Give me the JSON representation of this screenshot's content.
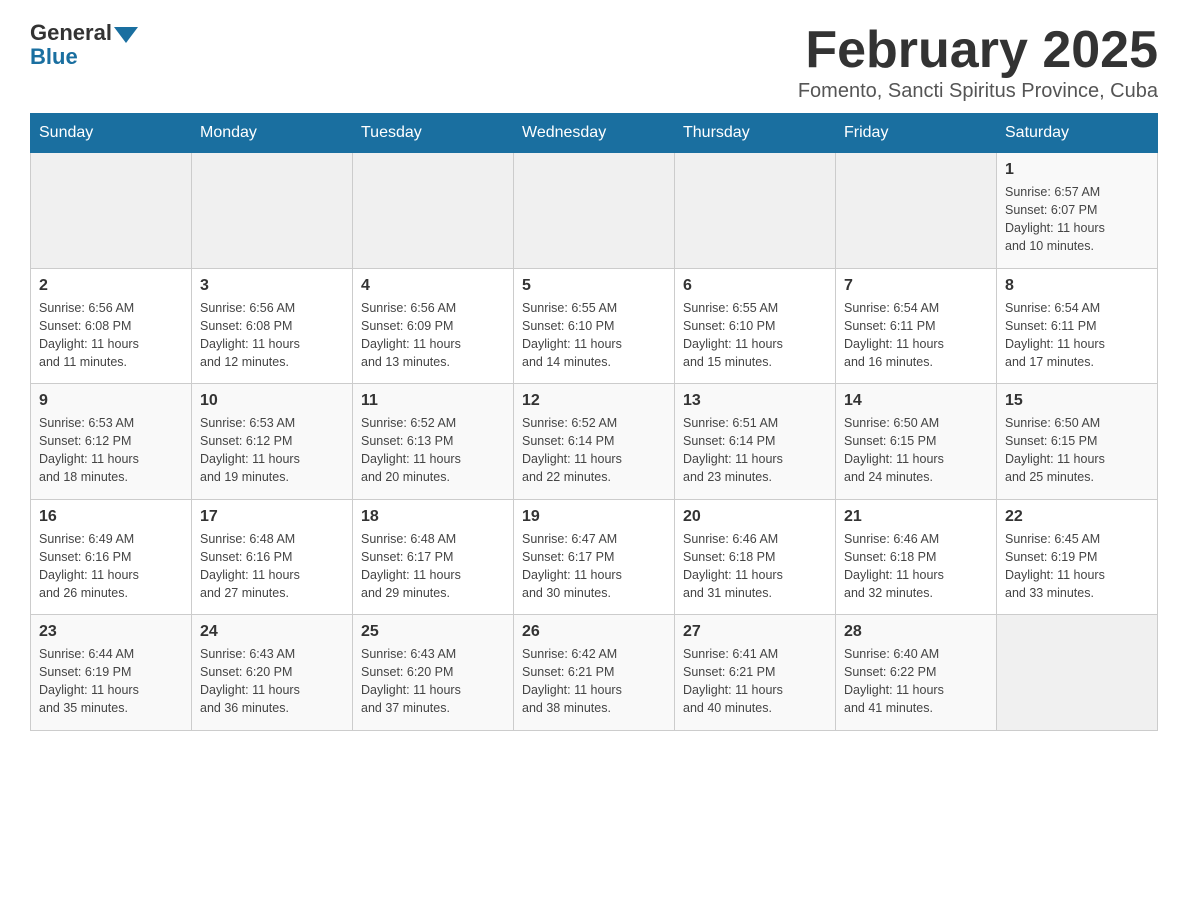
{
  "header": {
    "logo_general": "General",
    "logo_blue": "Blue",
    "month_title": "February 2025",
    "subtitle": "Fomento, Sancti Spiritus Province, Cuba"
  },
  "weekdays": [
    "Sunday",
    "Monday",
    "Tuesday",
    "Wednesday",
    "Thursday",
    "Friday",
    "Saturday"
  ],
  "weeks": [
    [
      {
        "day": "",
        "info": ""
      },
      {
        "day": "",
        "info": ""
      },
      {
        "day": "",
        "info": ""
      },
      {
        "day": "",
        "info": ""
      },
      {
        "day": "",
        "info": ""
      },
      {
        "day": "",
        "info": ""
      },
      {
        "day": "1",
        "info": "Sunrise: 6:57 AM\nSunset: 6:07 PM\nDaylight: 11 hours\nand 10 minutes."
      }
    ],
    [
      {
        "day": "2",
        "info": "Sunrise: 6:56 AM\nSunset: 6:08 PM\nDaylight: 11 hours\nand 11 minutes."
      },
      {
        "day": "3",
        "info": "Sunrise: 6:56 AM\nSunset: 6:08 PM\nDaylight: 11 hours\nand 12 minutes."
      },
      {
        "day": "4",
        "info": "Sunrise: 6:56 AM\nSunset: 6:09 PM\nDaylight: 11 hours\nand 13 minutes."
      },
      {
        "day": "5",
        "info": "Sunrise: 6:55 AM\nSunset: 6:10 PM\nDaylight: 11 hours\nand 14 minutes."
      },
      {
        "day": "6",
        "info": "Sunrise: 6:55 AM\nSunset: 6:10 PM\nDaylight: 11 hours\nand 15 minutes."
      },
      {
        "day": "7",
        "info": "Sunrise: 6:54 AM\nSunset: 6:11 PM\nDaylight: 11 hours\nand 16 minutes."
      },
      {
        "day": "8",
        "info": "Sunrise: 6:54 AM\nSunset: 6:11 PM\nDaylight: 11 hours\nand 17 minutes."
      }
    ],
    [
      {
        "day": "9",
        "info": "Sunrise: 6:53 AM\nSunset: 6:12 PM\nDaylight: 11 hours\nand 18 minutes."
      },
      {
        "day": "10",
        "info": "Sunrise: 6:53 AM\nSunset: 6:12 PM\nDaylight: 11 hours\nand 19 minutes."
      },
      {
        "day": "11",
        "info": "Sunrise: 6:52 AM\nSunset: 6:13 PM\nDaylight: 11 hours\nand 20 minutes."
      },
      {
        "day": "12",
        "info": "Sunrise: 6:52 AM\nSunset: 6:14 PM\nDaylight: 11 hours\nand 22 minutes."
      },
      {
        "day": "13",
        "info": "Sunrise: 6:51 AM\nSunset: 6:14 PM\nDaylight: 11 hours\nand 23 minutes."
      },
      {
        "day": "14",
        "info": "Sunrise: 6:50 AM\nSunset: 6:15 PM\nDaylight: 11 hours\nand 24 minutes."
      },
      {
        "day": "15",
        "info": "Sunrise: 6:50 AM\nSunset: 6:15 PM\nDaylight: 11 hours\nand 25 minutes."
      }
    ],
    [
      {
        "day": "16",
        "info": "Sunrise: 6:49 AM\nSunset: 6:16 PM\nDaylight: 11 hours\nand 26 minutes."
      },
      {
        "day": "17",
        "info": "Sunrise: 6:48 AM\nSunset: 6:16 PM\nDaylight: 11 hours\nand 27 minutes."
      },
      {
        "day": "18",
        "info": "Sunrise: 6:48 AM\nSunset: 6:17 PM\nDaylight: 11 hours\nand 29 minutes."
      },
      {
        "day": "19",
        "info": "Sunrise: 6:47 AM\nSunset: 6:17 PM\nDaylight: 11 hours\nand 30 minutes."
      },
      {
        "day": "20",
        "info": "Sunrise: 6:46 AM\nSunset: 6:18 PM\nDaylight: 11 hours\nand 31 minutes."
      },
      {
        "day": "21",
        "info": "Sunrise: 6:46 AM\nSunset: 6:18 PM\nDaylight: 11 hours\nand 32 minutes."
      },
      {
        "day": "22",
        "info": "Sunrise: 6:45 AM\nSunset: 6:19 PM\nDaylight: 11 hours\nand 33 minutes."
      }
    ],
    [
      {
        "day": "23",
        "info": "Sunrise: 6:44 AM\nSunset: 6:19 PM\nDaylight: 11 hours\nand 35 minutes."
      },
      {
        "day": "24",
        "info": "Sunrise: 6:43 AM\nSunset: 6:20 PM\nDaylight: 11 hours\nand 36 minutes."
      },
      {
        "day": "25",
        "info": "Sunrise: 6:43 AM\nSunset: 6:20 PM\nDaylight: 11 hours\nand 37 minutes."
      },
      {
        "day": "26",
        "info": "Sunrise: 6:42 AM\nSunset: 6:21 PM\nDaylight: 11 hours\nand 38 minutes."
      },
      {
        "day": "27",
        "info": "Sunrise: 6:41 AM\nSunset: 6:21 PM\nDaylight: 11 hours\nand 40 minutes."
      },
      {
        "day": "28",
        "info": "Sunrise: 6:40 AM\nSunset: 6:22 PM\nDaylight: 11 hours\nand 41 minutes."
      },
      {
        "day": "",
        "info": ""
      }
    ]
  ]
}
